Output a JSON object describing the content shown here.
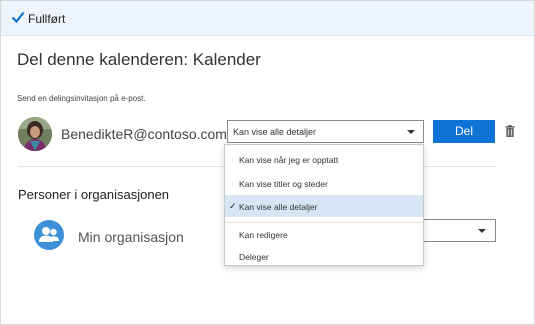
{
  "topbar": {
    "status_label": "Fullført",
    "icon": "checkmark-icon"
  },
  "dialog": {
    "title": "Del denne kalenderen: Kalender",
    "invite_label": "Send en delingsinvitasjon på e-post.",
    "recipient": {
      "email": "BenedikteR@contoso.com",
      "permission_selected": "Kan vise alle detaljer",
      "share_button": "Del",
      "delete_icon": "trash-icon"
    },
    "permission_options": [
      {
        "label": "Kan vise når jeg er opptatt",
        "selected": false
      },
      {
        "label": "Kan vise titler og steder",
        "selected": false
      },
      {
        "label": "Kan vise alle detaljer",
        "selected": true
      },
      {
        "label": "Kan redigere",
        "selected": false
      },
      {
        "label": "Deleger",
        "selected": false
      }
    ],
    "organization": {
      "section_title": "Personer i organisasjonen",
      "label": "Min organisasjon",
      "icon": "people-icon"
    }
  },
  "colors": {
    "accent": "#1073d6",
    "topbar_bg": "#eef4fb",
    "selected_option_bg": "#d6e6f5",
    "org_icon_bg": "#3d8fd8"
  }
}
